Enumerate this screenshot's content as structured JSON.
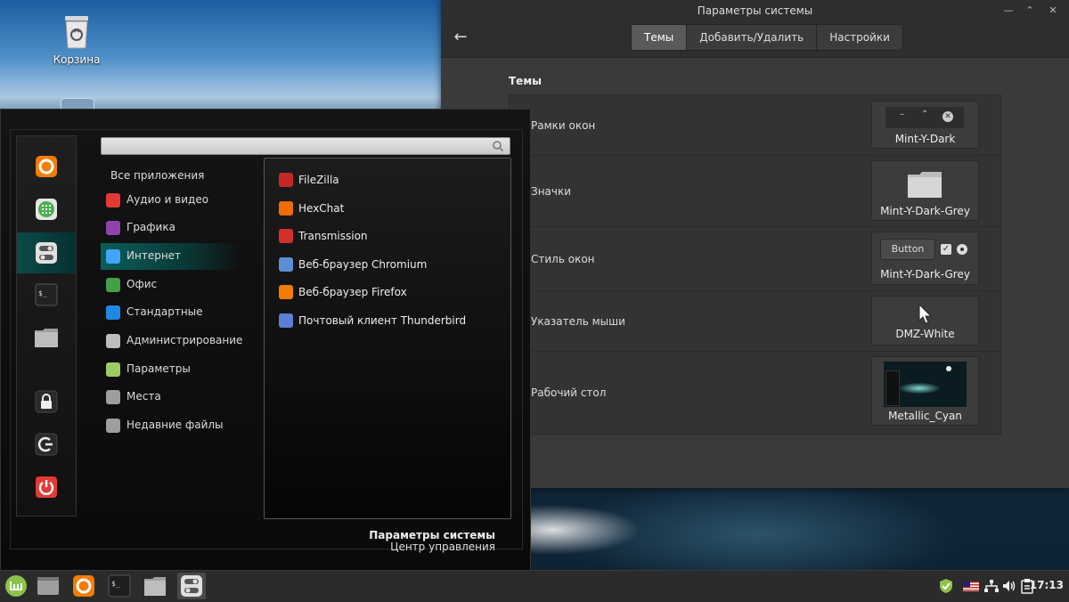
{
  "desktop": {
    "trash_label": "Корзина"
  },
  "settings_window": {
    "title": "Параметры системы",
    "tabs": [
      {
        "label": "Темы",
        "active": true
      },
      {
        "label": "Добавить/Удалить",
        "active": false
      },
      {
        "label": "Настройки",
        "active": false
      }
    ],
    "section_title": "Темы",
    "rows": [
      {
        "label": "Рамки окон",
        "value": "Mint-Y-Dark"
      },
      {
        "label": "Значки",
        "value": "Mint-Y-Dark-Grey"
      },
      {
        "label": "Стиль окон",
        "value": "Mint-Y-Dark-Grey",
        "preview_button": "Button"
      },
      {
        "label": "Указатель мыши",
        "value": "DMZ-White"
      },
      {
        "label": "Рабочий стол",
        "value": "Metallic_Cyan"
      }
    ]
  },
  "menu": {
    "search": {
      "value": "",
      "placeholder": ""
    },
    "all_apps": "Все приложения",
    "categories": [
      {
        "label": "Аудио и видео",
        "color": "#e53935"
      },
      {
        "label": "Графика",
        "color": "#8e44ad"
      },
      {
        "label": "Интернет",
        "color": "#42a5f5",
        "active": true
      },
      {
        "label": "Офис",
        "color": "#43a047"
      },
      {
        "label": "Стандартные",
        "color": "#1e88e5"
      },
      {
        "label": "Администрирование",
        "color": "#bdbdbd"
      },
      {
        "label": "Параметры",
        "color": "#9ccc65"
      },
      {
        "label": "Места",
        "color": "#9e9e9e"
      },
      {
        "label": "Недавние файлы",
        "color": "#9e9e9e"
      }
    ],
    "apps": [
      {
        "label": "FileZilla",
        "color": "#c62828"
      },
      {
        "label": "HexChat",
        "color": "#ef6c00"
      },
      {
        "label": "Transmission",
        "color": "#d32f2f"
      },
      {
        "label": "Веб-браузер Chromium",
        "color": "#5c8ed6"
      },
      {
        "label": "Веб-браузер Firefox",
        "color": "#f57c00"
      },
      {
        "label": "Почтовый клиент Thunderbird",
        "color": "#5c7fd6"
      }
    ],
    "footer": {
      "title": "Параметры системы",
      "subtitle": "Центр управления"
    }
  },
  "panel": {
    "clock": "17:13"
  }
}
